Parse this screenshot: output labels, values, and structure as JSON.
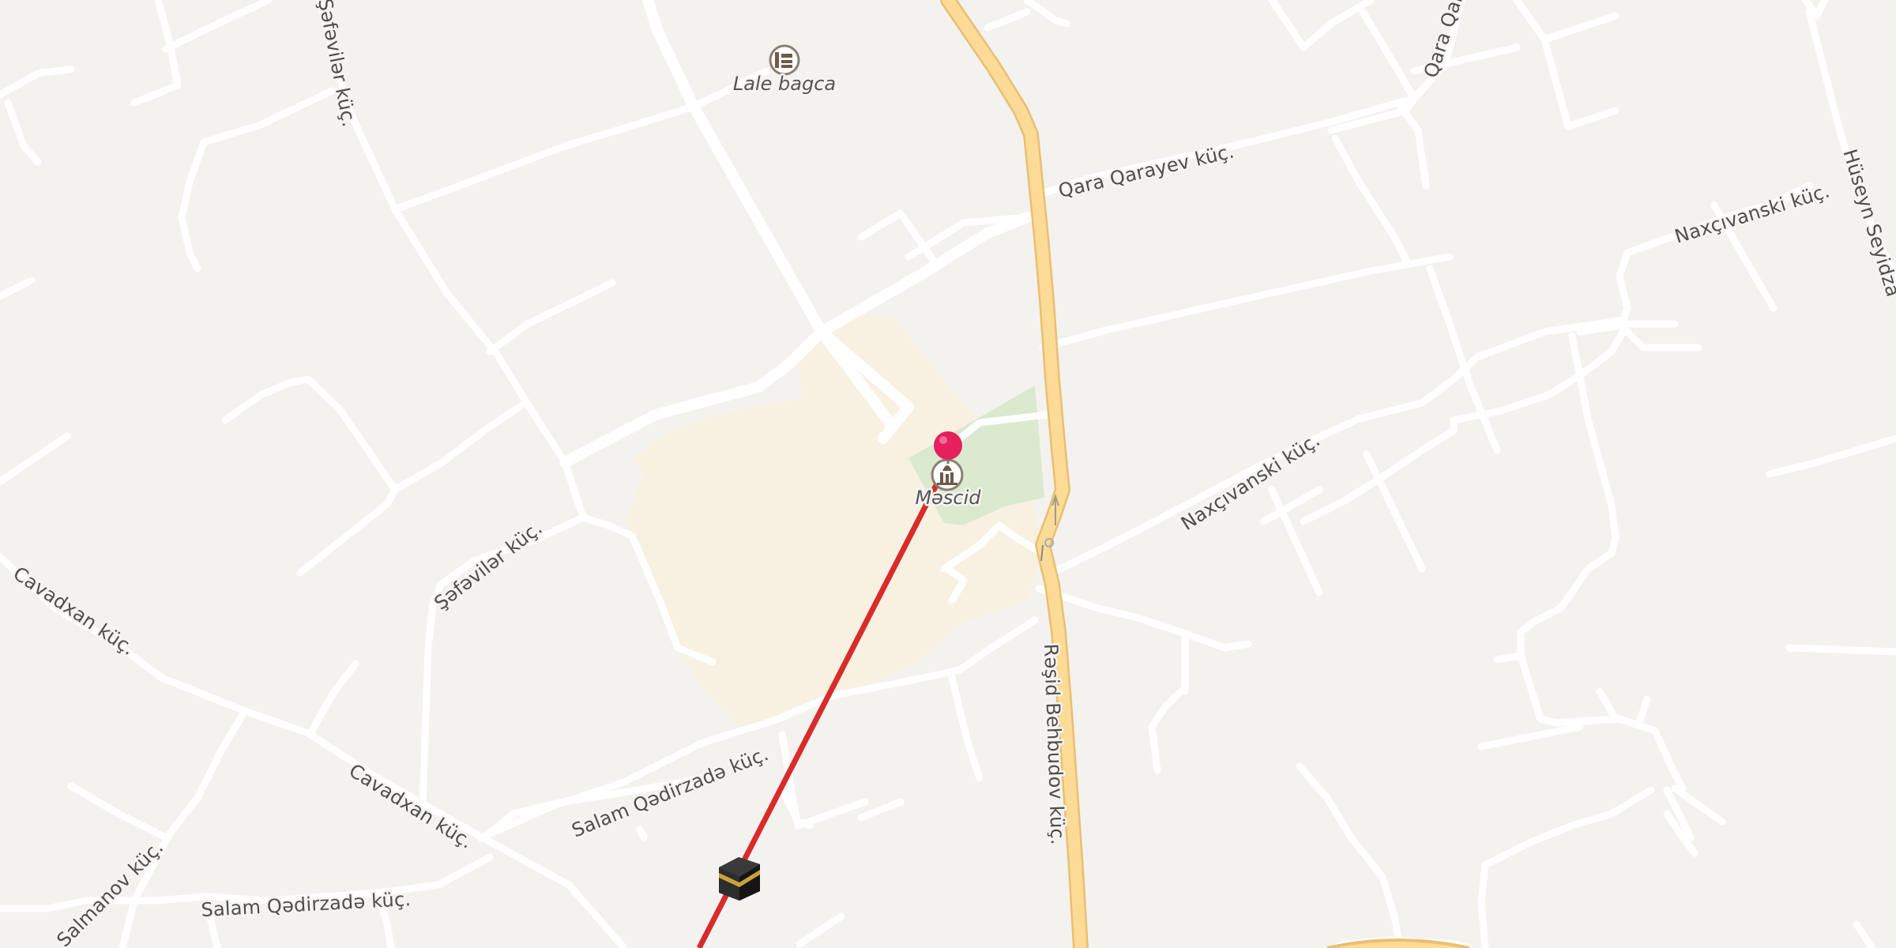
{
  "map": {
    "streets": [
      {
        "id": "safavilar-1",
        "name": "Şəfəvilər küç."
      },
      {
        "id": "safavilar-2",
        "name": "Şəfəvilər küç."
      },
      {
        "id": "qara-qarayev",
        "name": "Qara Qarayev küç."
      },
      {
        "id": "qara-qara-top",
        "name": "Qara Qara"
      },
      {
        "id": "naxcivanski-1",
        "name": "Naxçıvanski küç."
      },
      {
        "id": "naxcivanski-2",
        "name": "Naxçıvanski küç."
      },
      {
        "id": "huseyn",
        "name": "Hüseyn Seyidza"
      },
      {
        "id": "cavadxan-1",
        "name": "Cavadxan küç."
      },
      {
        "id": "cavadxan-2",
        "name": "Cavadxan küç."
      },
      {
        "id": "salam-1",
        "name": "Salam Qədirzadə küç."
      },
      {
        "id": "salam-2",
        "name": "Salam Qədirzadə küç."
      },
      {
        "id": "salmanov",
        "name": "Salmanov küç."
      },
      {
        "id": "rashid",
        "name": "Rəşid Behbudov küç."
      }
    ],
    "pois": [
      {
        "id": "lale",
        "label": "Lale bagca",
        "icon": "kindergarten-icon"
      },
      {
        "id": "mascid",
        "label": "Məscid",
        "icon": "mosque-icon"
      }
    ],
    "markers": {
      "selected_pin": "map-pin-icon",
      "qibla_target": "kaaba-icon"
    },
    "qibla_line": {
      "color": "#d92b2b"
    },
    "colors": {
      "background": "#f4f2ef",
      "road": "#ffffff",
      "main_road": "#fbdb96",
      "main_road_casing": "#e9bf73",
      "park": "#dbe9cf",
      "landuse": "#f8f1e1",
      "pin": "#e5205d"
    }
  }
}
